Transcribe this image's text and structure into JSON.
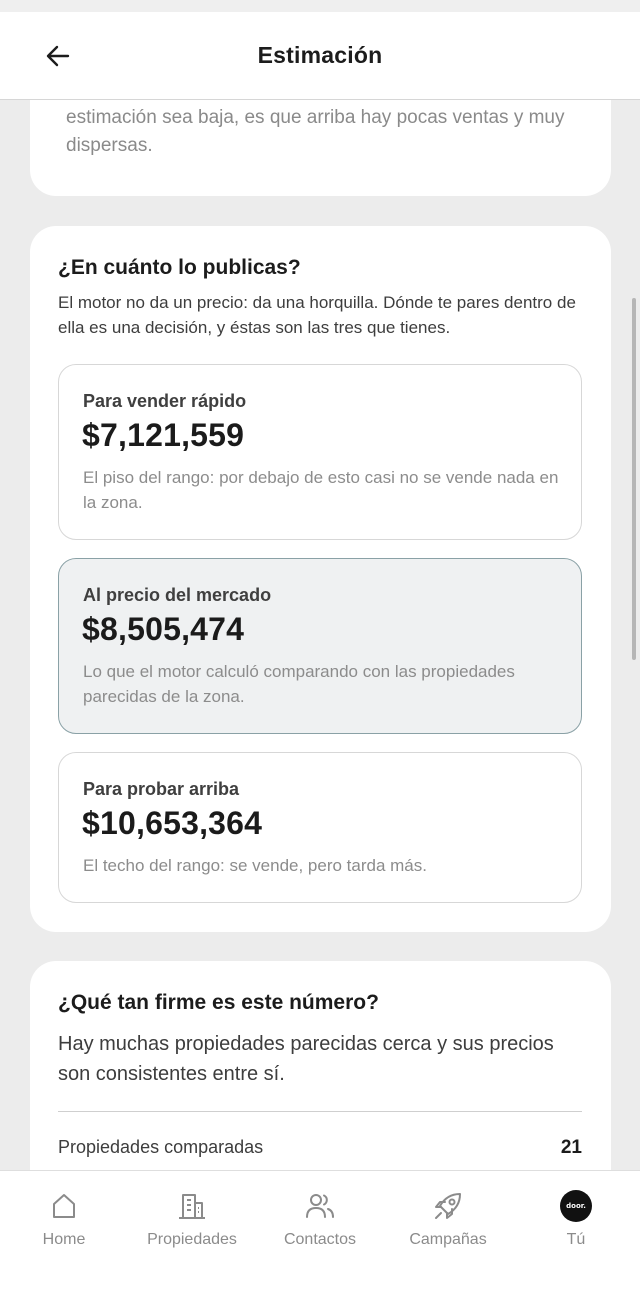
{
  "header": {
    "title": "Estimación"
  },
  "intro_card": {
    "text": "estimación sea baja, es que arriba hay pocas ventas y muy dispersas."
  },
  "pricing": {
    "title": "¿En cuánto lo publicas?",
    "subtitle": "El motor no da un precio: da una horquilla. Dónde te pares dentro de ella es una decisión, y éstas son las tres que tienes.",
    "options": [
      {
        "label": "Para vender rápido",
        "price": "$7,121,559",
        "description": "El piso del rango: por debajo de esto casi no se vende nada en la zona."
      },
      {
        "label": "Al precio del mercado",
        "price": "$8,505,474",
        "description": "Lo que el motor calculó comparando con las propiedades parecidas de la zona."
      },
      {
        "label": "Para probar arriba",
        "price": "$10,653,364",
        "description": "El techo del rango: se vende, pero tarda más."
      }
    ],
    "selected_option": "Al precio del mercado"
  },
  "firmness": {
    "title": "¿Qué tan firme es este número?",
    "body": "Hay muchas propiedades parecidas cerca y sus precios son consistentes entre sí.",
    "stats": [
      {
        "label": "Propiedades comparadas",
        "value": "21"
      }
    ]
  },
  "nav": {
    "items": [
      {
        "label": "Home",
        "icon": "home-icon"
      },
      {
        "label": "Propiedades",
        "icon": "building-icon"
      },
      {
        "label": "Contactos",
        "icon": "users-icon"
      },
      {
        "label": "Campañas",
        "icon": "rocket-icon"
      },
      {
        "label": "Tú",
        "icon": "avatar",
        "avatar_text": "door."
      }
    ]
  },
  "colors": {
    "selected_bg": "#eff1f2",
    "selected_border": "#8aa1a6",
    "nav_inactive": "#8b8b8b",
    "page_bg": "#ececec"
  }
}
